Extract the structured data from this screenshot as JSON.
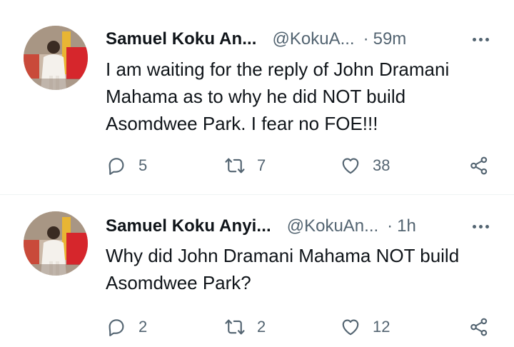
{
  "tweets": [
    {
      "name": "Samuel Koku An...",
      "handle": "@KokuA...",
      "dot": "·",
      "time": "59m",
      "text": "I am waiting for the reply of John Dramani Mahama as to why he did NOT build Asomdwee Park. I fear no FOE!!!",
      "replies": "5",
      "retweets": "7",
      "likes": "38"
    },
    {
      "name": "Samuel Koku Anyi...",
      "handle": "@KokuAn...",
      "dot": "·",
      "time": "1h",
      "text": "Why did John Dramani Mahama NOT build Asomdwee Park?",
      "replies": "2",
      "retweets": "2",
      "likes": "12"
    }
  ],
  "icons": {
    "more": "more-horizontal-icon",
    "reply": "reply-icon",
    "retweet": "retweet-icon",
    "like": "heart-icon",
    "share": "share-icon"
  },
  "colors": {
    "text": "#0f1419",
    "secondary": "#536471",
    "divider": "#eff3f4"
  }
}
